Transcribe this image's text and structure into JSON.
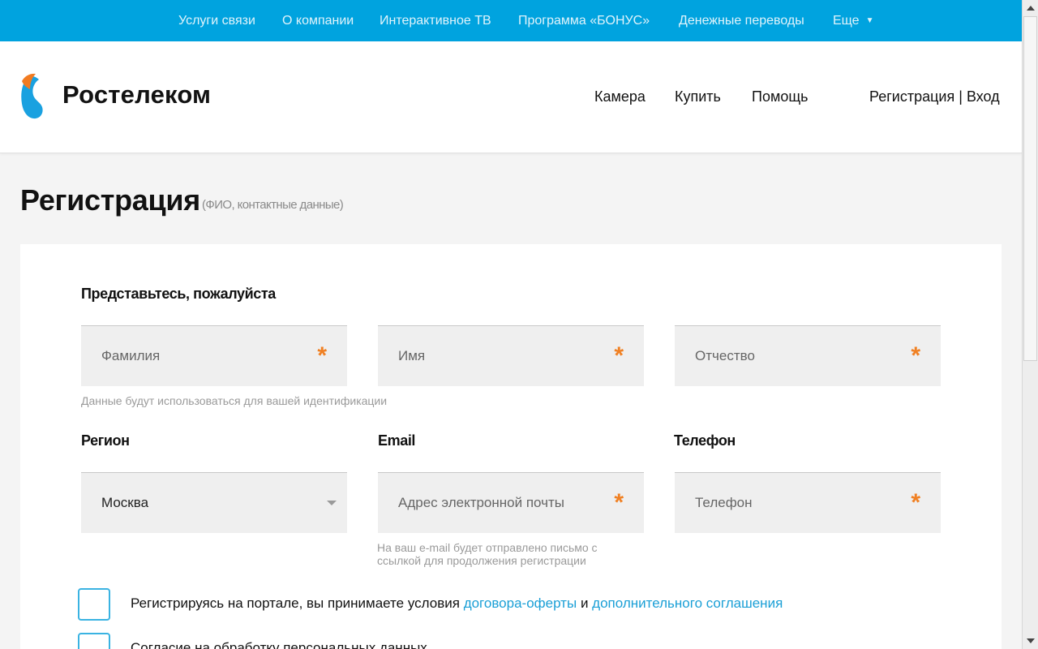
{
  "top_nav": {
    "items": [
      "Услуги связи",
      "О компании",
      "Интерактивное ТВ",
      "Программа «БОНУС»",
      "Денежные переводы",
      "Еще"
    ]
  },
  "header": {
    "brand": "Ростелеком",
    "nav": [
      "Камера",
      "Купить",
      "Помощь"
    ],
    "register": "Регистрация",
    "separator": "|",
    "login": "Вход"
  },
  "page": {
    "title": "Регистрация",
    "subtitle": "(ФИО, контактные данные)"
  },
  "form": {
    "intro_label": "Представьтесь, пожалуйста",
    "last_name_placeholder": "Фамилия",
    "first_name_placeholder": "Имя",
    "middle_name_placeholder": "Отчество",
    "required_mark": "*",
    "identification_hint": "Данные будут использоваться для вашей идентификации",
    "region_label": "Регион",
    "region_value": "Москва",
    "email_label": "Email",
    "email_placeholder": "Адрес электронной почты",
    "email_hint_line1": "На ваш e-mail будет отправлено письмо с",
    "email_hint_line2": "ссылкой для продолжения регистрации",
    "phone_label": "Телефон",
    "phone_placeholder": "Телефон",
    "terms_text": "Регистрируясь на портале, вы принимаете условия",
    "terms_link_offer": "договора-оферты",
    "terms_and": "и",
    "terms_link_agreement": "дополнительного соглашения",
    "consent_text": "Согласие на обработку персональных данных"
  },
  "colors": {
    "top_bar": "#00a3df",
    "accent_orange": "#f08023",
    "link_blue": "#1a9fd6"
  },
  "icons": {
    "logo": "rostelecom-logo-icon",
    "more_caret": "caret-down-icon",
    "region_dropdown": "chevron-down-icon"
  }
}
